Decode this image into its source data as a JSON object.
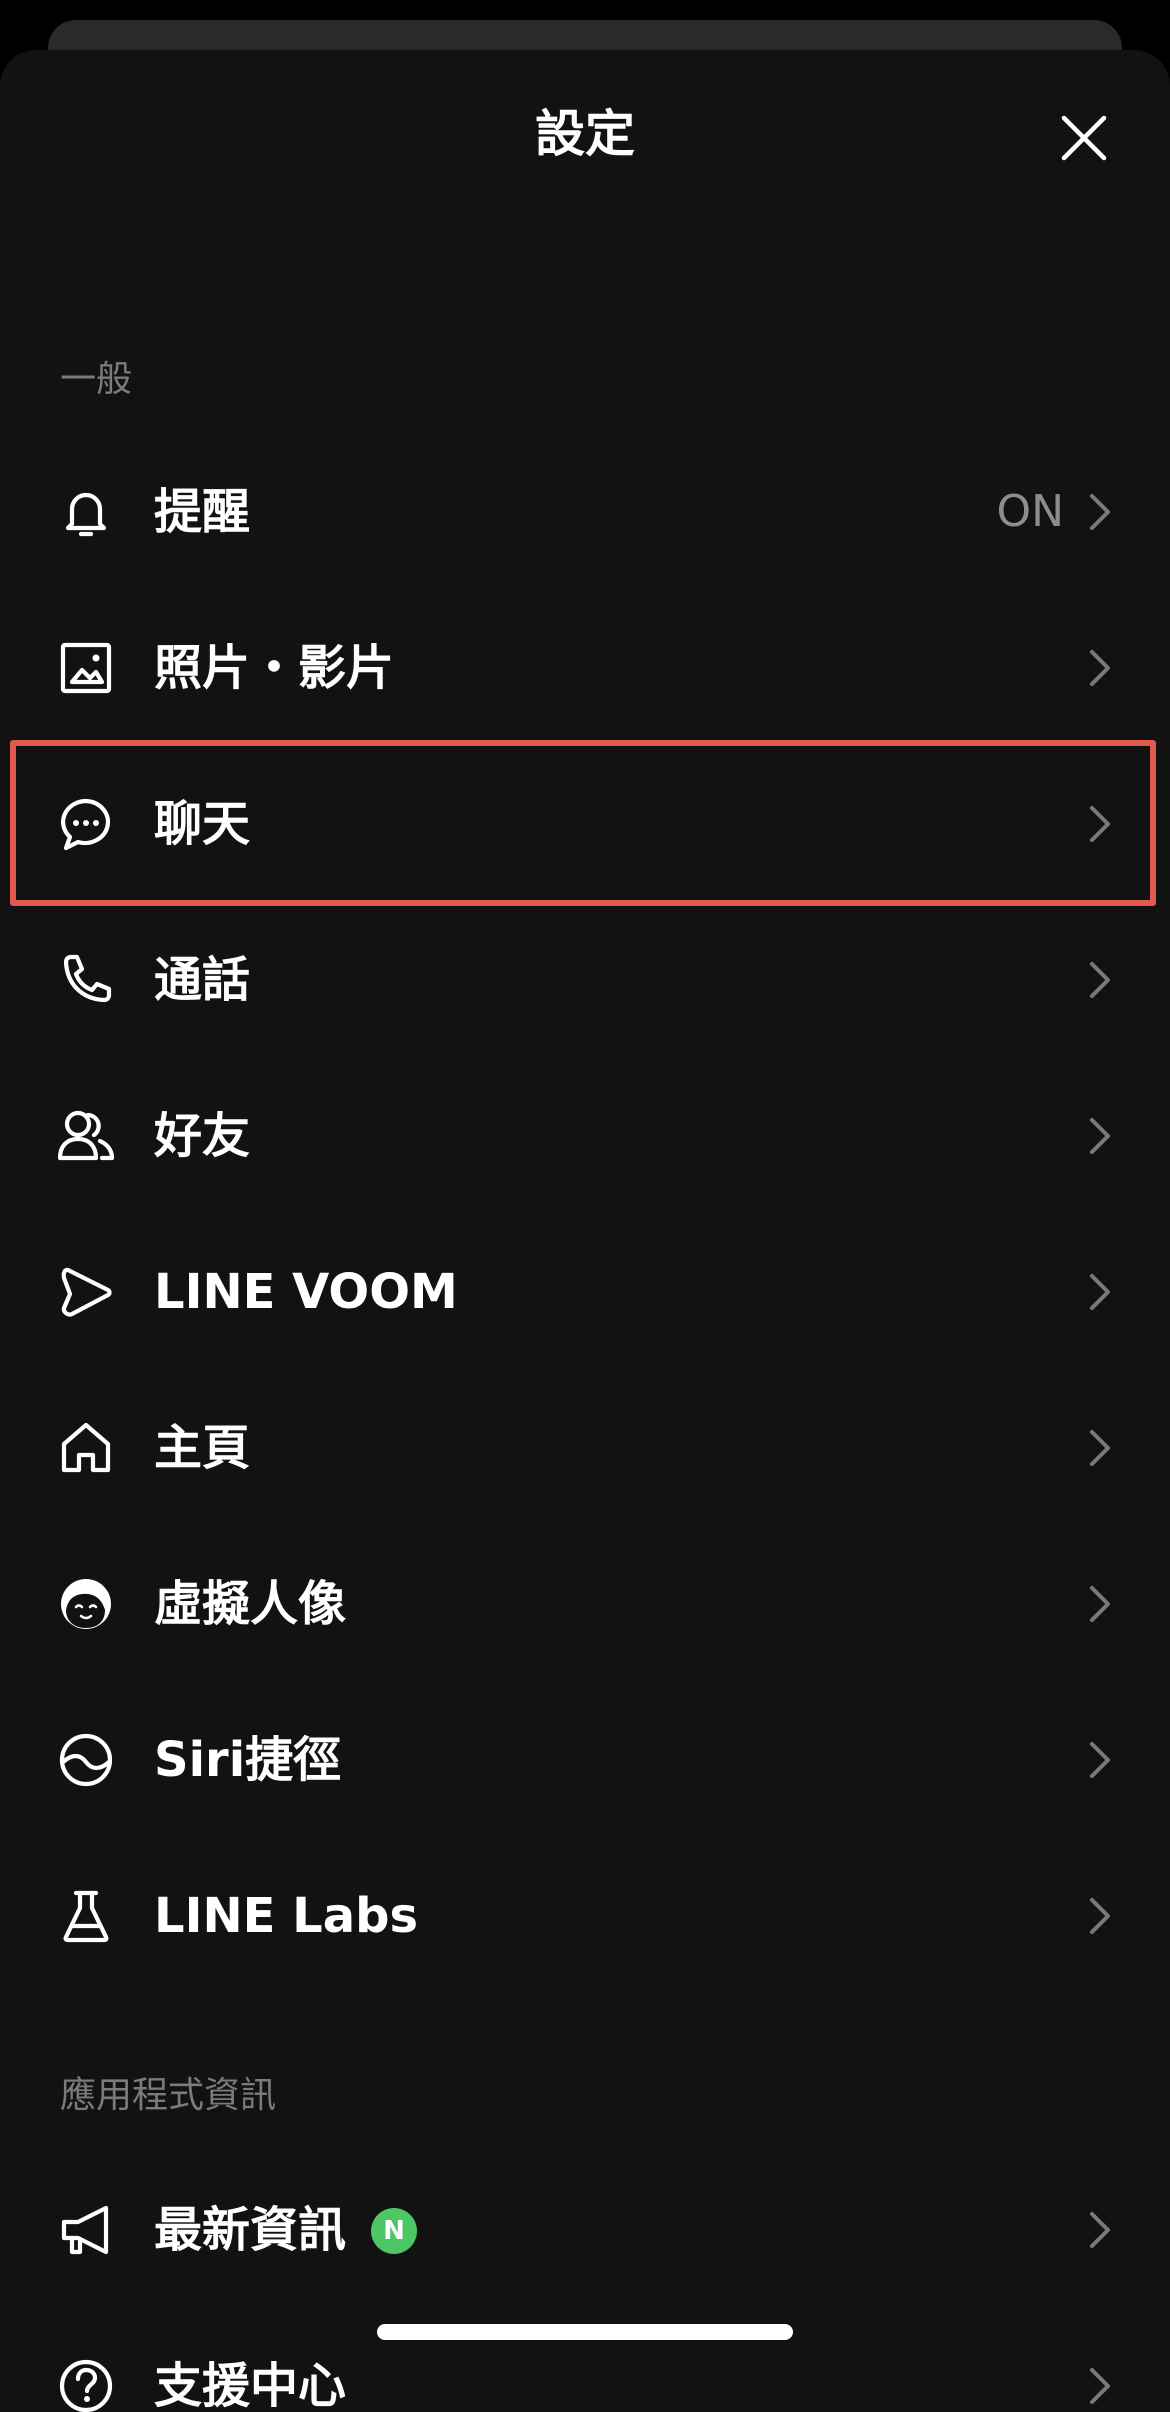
{
  "header": {
    "title": "設定"
  },
  "sections": {
    "general": "一般",
    "app_info": "應用程式資訊"
  },
  "rows": {
    "notifications": {
      "label": "提醒",
      "value": "ON",
      "icon": "bell-icon"
    },
    "photos_videos": {
      "label": "照片・影片",
      "icon": "image-icon"
    },
    "chats": {
      "label": "聊天",
      "icon": "chat-bubble-icon"
    },
    "calls": {
      "label": "通話",
      "icon": "phone-icon"
    },
    "friends": {
      "label": "好友",
      "icon": "friends-icon"
    },
    "line_voom": {
      "label": "LINE VOOM",
      "icon": "voom-play-icon"
    },
    "home": {
      "label": "主頁",
      "icon": "home-icon"
    },
    "avatar": {
      "label": "虛擬人像",
      "icon": "avatar-face-icon"
    },
    "siri": {
      "label": "Siri捷徑",
      "icon": "siri-shortcut-icon"
    },
    "line_labs": {
      "label": "LINE Labs",
      "icon": "flask-icon"
    },
    "news": {
      "label": "最新資訊",
      "badge": "N",
      "icon": "megaphone-icon"
    },
    "help": {
      "label": "支援中心",
      "icon": "question-circle-icon"
    }
  },
  "colors": {
    "background": "#121212",
    "highlight": "#e05a4f",
    "badge": "#4cc764",
    "section_text": "#7b7b7b"
  }
}
